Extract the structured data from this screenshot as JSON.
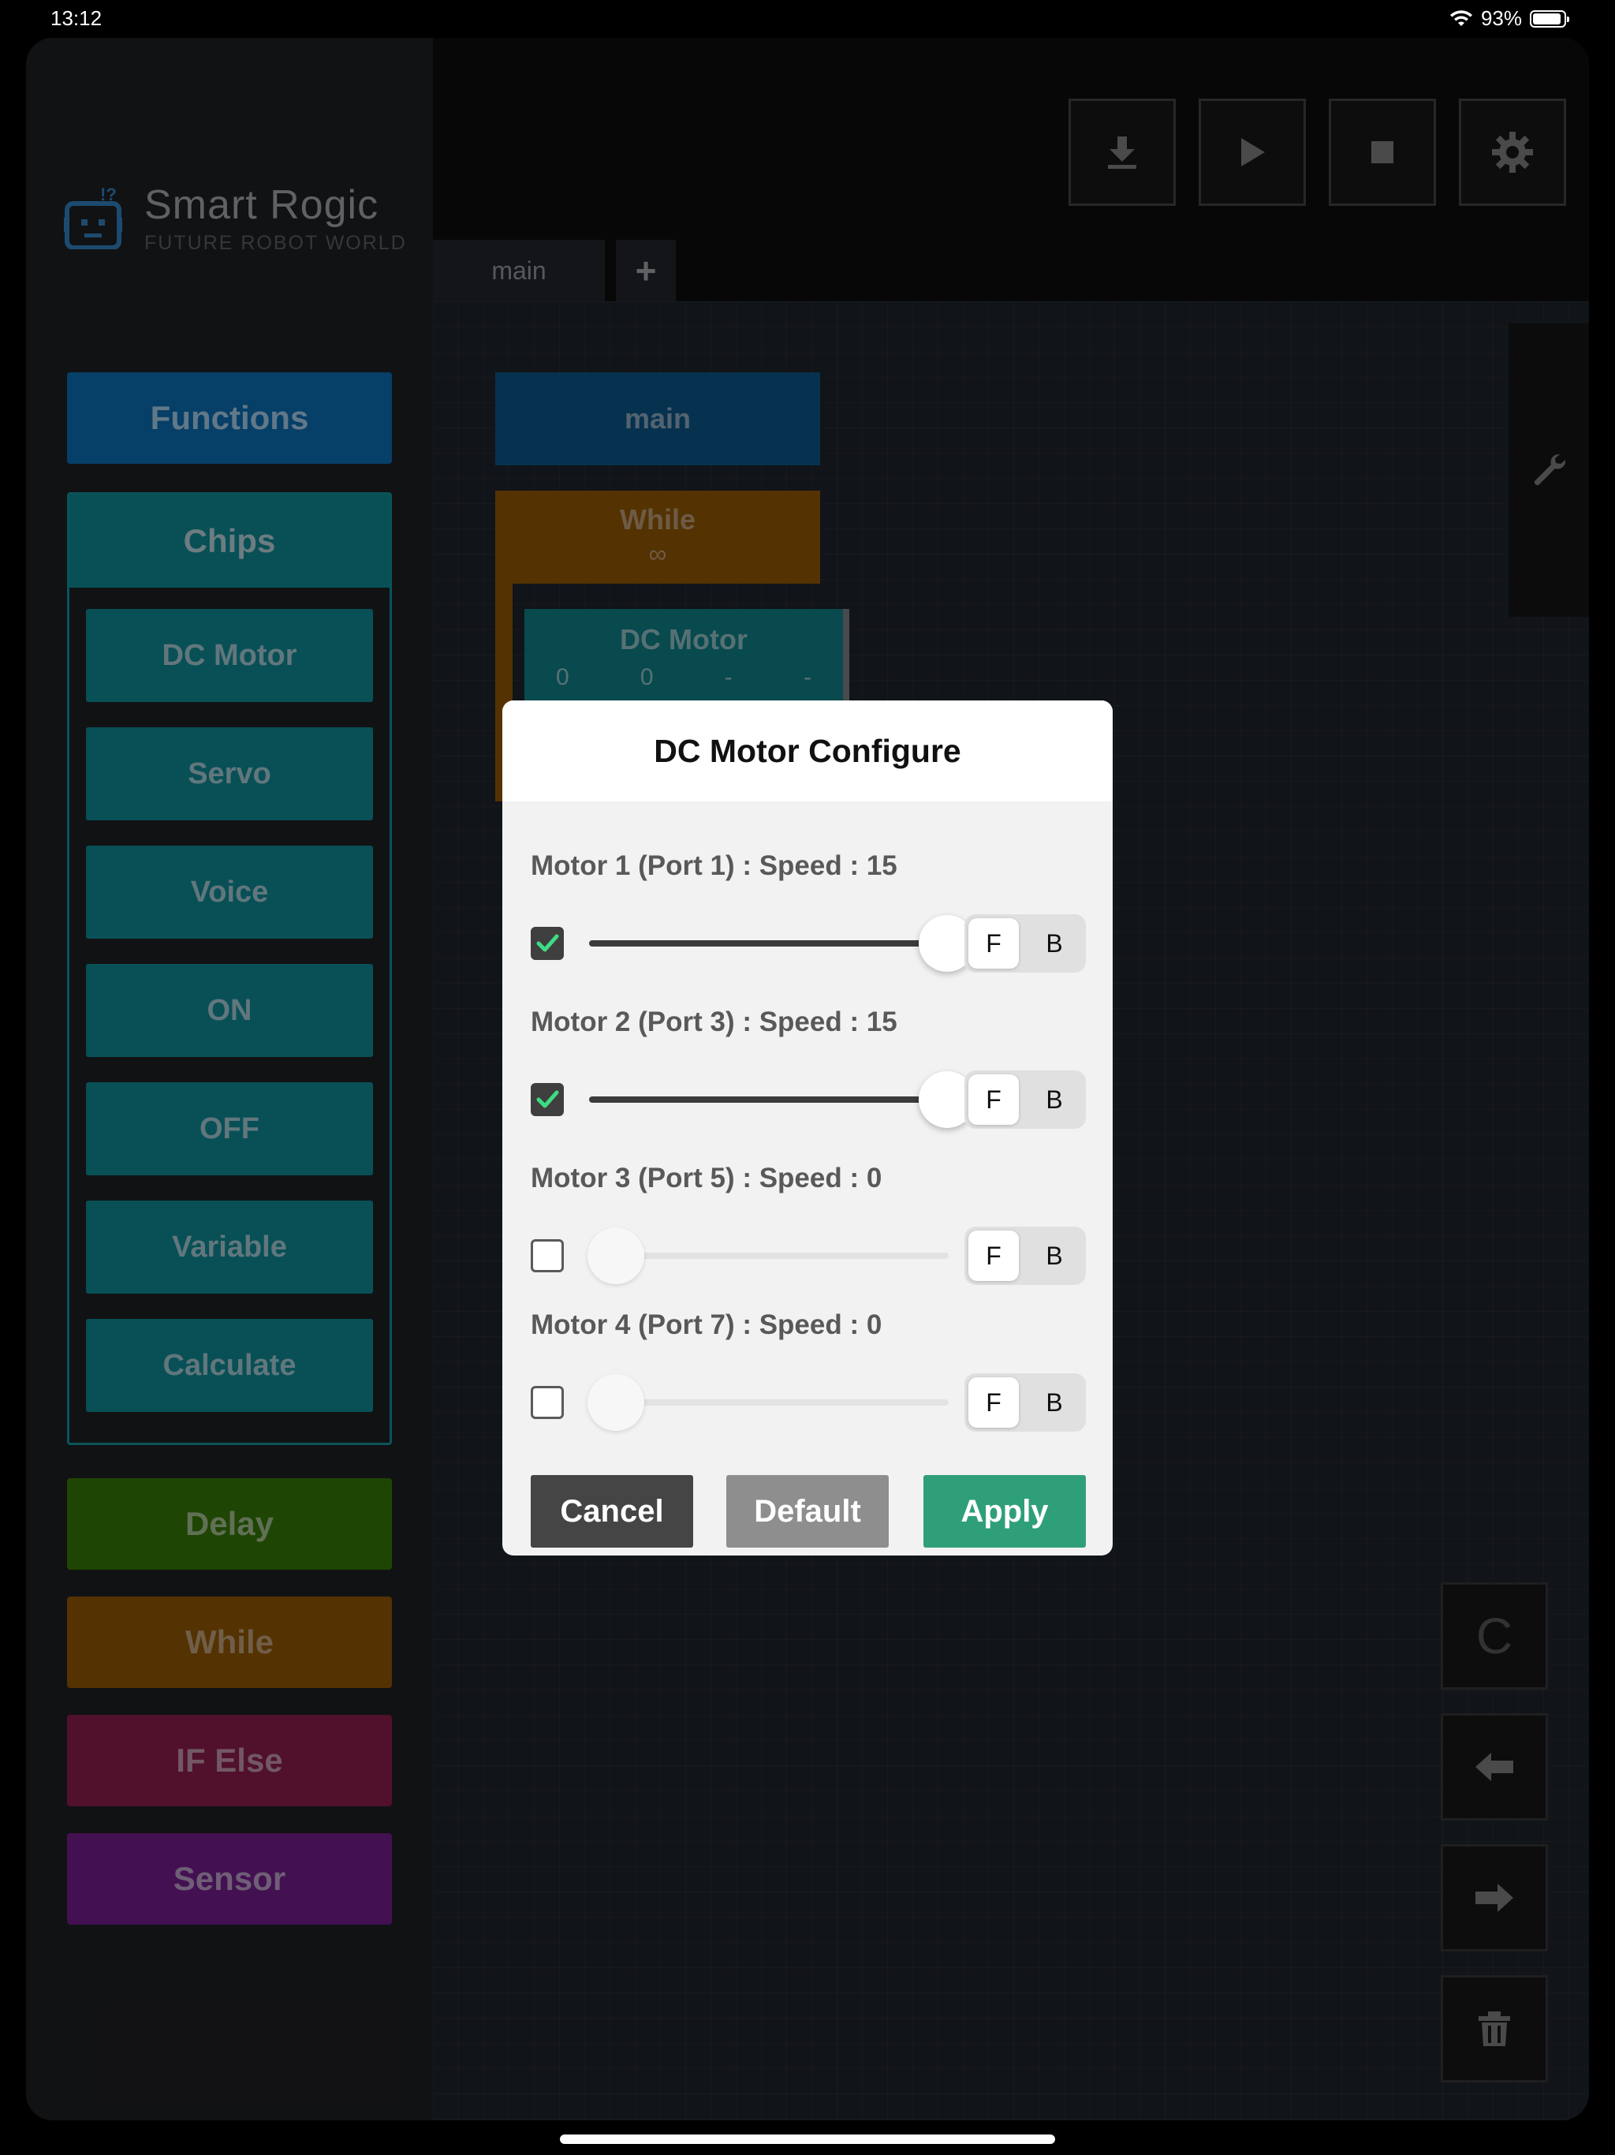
{
  "status": {
    "time": "13:12",
    "battery": "93%"
  },
  "logo": {
    "title": "Smart Rogic",
    "subtitle": "FUTURE ROBOT WORLD"
  },
  "palette": {
    "functions": "Functions",
    "chips": "Chips",
    "chip_items": [
      "DC Motor",
      "Servo",
      "Voice",
      "ON",
      "OFF",
      "Variable",
      "Calculate"
    ],
    "delay": "Delay",
    "while": "While",
    "if_else": "IF Else",
    "sensor": "Sensor"
  },
  "colors": {
    "functions": "#0a5e9a",
    "chips": "#0d777f",
    "delay": "#2e6607",
    "while": "#7c4a03",
    "if_else": "#781941",
    "sensor": "#641a78",
    "apply": "#2f9f7a",
    "cancel": "#454545",
    "default": "#8e8e8e"
  },
  "toolbar": {
    "icons": [
      "download-icon",
      "play-icon",
      "stop-icon",
      "gear-icon"
    ]
  },
  "tabs": {
    "main": "main",
    "add": "+"
  },
  "canvas": {
    "main_block": "main",
    "while_block": {
      "label": "While",
      "value": "∞"
    },
    "dc_block": {
      "label": "DC Motor",
      "values": [
        "0",
        "0",
        "-",
        "-"
      ]
    }
  },
  "side_buttons": {
    "clear": "C"
  },
  "modal": {
    "title": "DC Motor Configure",
    "motors": [
      {
        "label": "Motor 1 (Port 1) : Speed : 15",
        "checked": true,
        "level": 1.0,
        "dir_f": "F",
        "dir_b": "B"
      },
      {
        "label": "Motor 2 (Port 3) : Speed : 15",
        "checked": true,
        "level": 1.0,
        "dir_f": "F",
        "dir_b": "B"
      },
      {
        "label": "Motor 3 (Port 5) : Speed : 0",
        "checked": false,
        "level": 0,
        "dir_f": "F",
        "dir_b": "B"
      },
      {
        "label": "Motor 4 (Port 7) : Speed : 0",
        "checked": false,
        "level": 0,
        "dir_f": "F",
        "dir_b": "B"
      }
    ],
    "cancel": "Cancel",
    "default": "Default",
    "apply": "Apply"
  }
}
